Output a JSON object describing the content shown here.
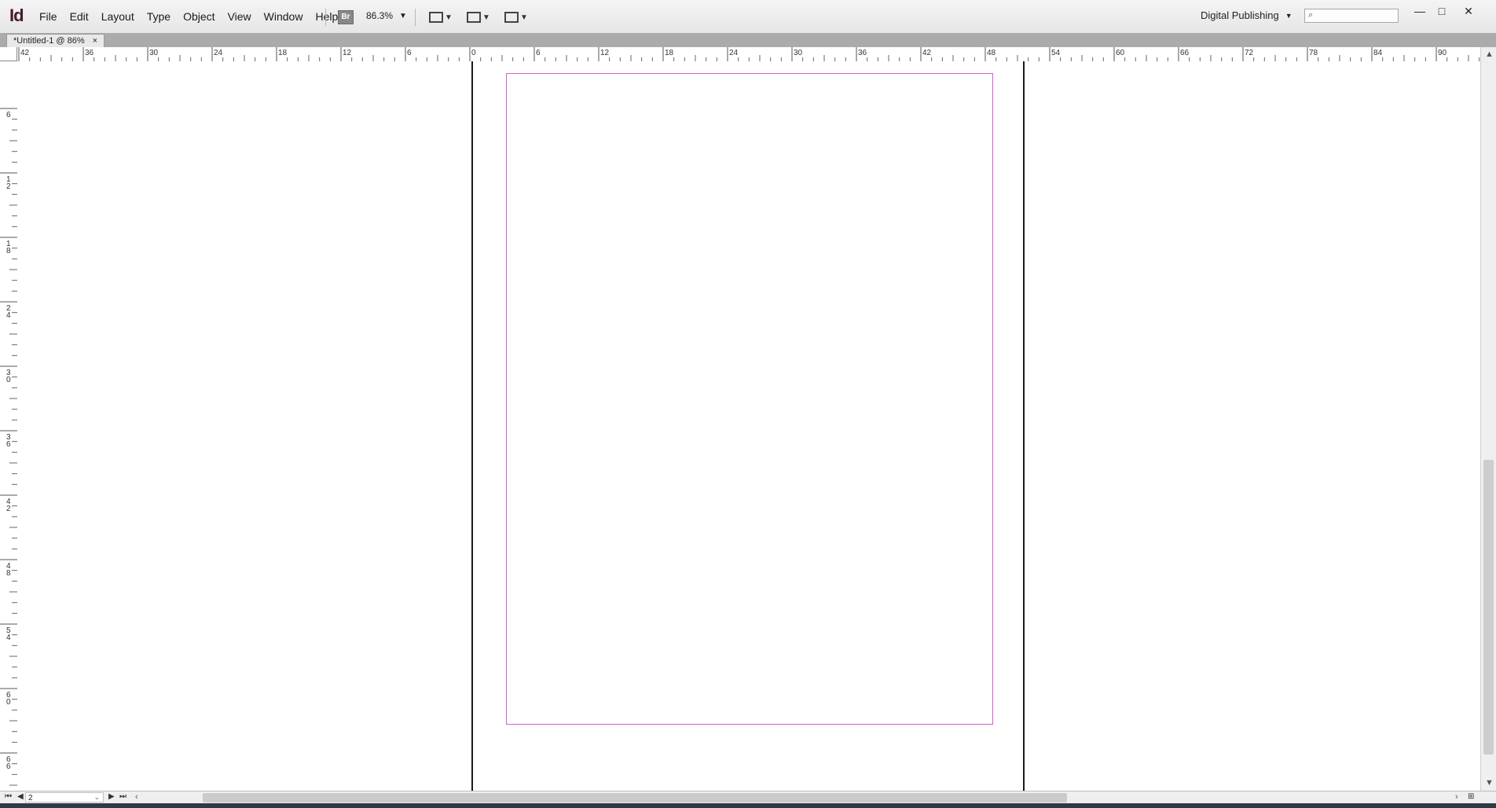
{
  "app": {
    "logo": "Id",
    "menu": [
      "File",
      "Edit",
      "Layout",
      "Type",
      "Object",
      "View",
      "Window",
      "Help"
    ],
    "bridge_label": "Br",
    "zoom_value": "86.3%",
    "workspace": "Digital Publishing",
    "search_placeholder": "",
    "window_controls": {
      "minimize": "—",
      "maximize": "□",
      "close": "✕"
    }
  },
  "document": {
    "tab_title": "*Untitled-1 @ 86%",
    "tab_close": "×"
  },
  "rulers": {
    "horizontal_labels": [
      "42",
      "36",
      "30",
      "24",
      "18",
      "12",
      "6",
      "0",
      "6",
      "12",
      "18",
      "24",
      "30",
      "36",
      "42",
      "48",
      "54",
      "60",
      "66",
      "72",
      "78",
      "84",
      "90"
    ],
    "vertical_labels": [
      "6",
      "12",
      "18",
      "24",
      "30",
      "36",
      "42",
      "48",
      "54",
      "60",
      "66"
    ]
  },
  "statusbar": {
    "page_number": "2"
  },
  "colors": {
    "margin_guide": "#d35fce",
    "page_border": "#1a1a1a",
    "logo": "#4a1734"
  }
}
